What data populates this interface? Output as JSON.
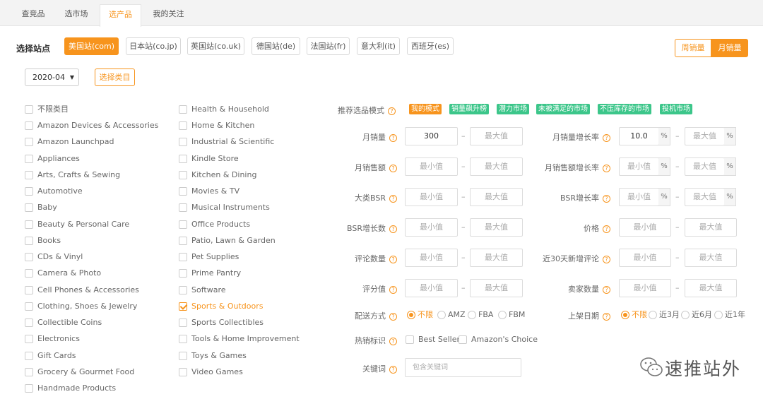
{
  "tabs": [
    "查竞品",
    "选市场",
    "选产品",
    "我的关注"
  ],
  "site_title": "选择站点",
  "sites": [
    "美国站(com)",
    "日本站(co.jp)",
    "英国站(co.uk)",
    "德国站(de)",
    "法国站(fr)",
    "意大利(it)",
    "西班牙(es)"
  ],
  "active_site": "美国站(com)",
  "sales_toggle": {
    "weekly": "周销量",
    "monthly": "月销量",
    "selected": "月销量"
  },
  "month": "2020-04",
  "select_category": "选择类目",
  "categories_left": [
    "不限类目",
    "Amazon Devices & Accessories",
    "Amazon Launchpad",
    "Appliances",
    "Arts, Crafts & Sewing",
    "Automotive",
    "Baby",
    "Beauty & Personal Care",
    "Books",
    "CDs & Vinyl",
    "Camera & Photo",
    "Cell Phones & Accessories",
    "Clothing, Shoes & Jewelry",
    "Collectible Coins",
    "Electronics",
    "Gift Cards",
    "Grocery & Gourmet Food",
    "Handmade Products"
  ],
  "categories_right": [
    "Health & Household",
    "Home & Kitchen",
    "Industrial & Scientific",
    "Kindle Store",
    "Kitchen & Dining",
    "Movies & TV",
    "Musical Instruments",
    "Office Products",
    "Patio, Lawn & Garden",
    "Pet Supplies",
    "Prime Pantry",
    "Software",
    "Sports & Outdoors",
    "Sports Collectibles",
    "Tools & Home Improvement",
    "Toys & Games",
    "Video Games"
  ],
  "checked_category": "Sports & Outdoors",
  "filters": {
    "mode_label": "推荐选品模式",
    "modes": [
      "我的模式",
      "销量飙升榜",
      "潜力市场",
      "未被满足的市场",
      "不压库存的市场",
      "投机市场"
    ],
    "active_mode": "我的模式",
    "min_placeholder": "最小值",
    "max_placeholder": "最大值",
    "dash": "–",
    "pct": "%",
    "help": "?",
    "monthly_sales": {
      "label": "月销量",
      "min": "300"
    },
    "monthly_sales_growth": {
      "label": "月销量增长率",
      "min": "10.0"
    },
    "monthly_revenue": {
      "label": "月销售额"
    },
    "monthly_revenue_growth": {
      "label": "月销售额增长率"
    },
    "category_bsr": {
      "label": "大类BSR"
    },
    "bsr_growth_rate": {
      "label": "BSR增长率"
    },
    "bsr_growth_count": {
      "label": "BSR增长数"
    },
    "price": {
      "label": "价格"
    },
    "review_count": {
      "label": "评论数量"
    },
    "new_reviews_30d": {
      "label": "近30天新增评论"
    },
    "rating": {
      "label": "评分值"
    },
    "seller_count": {
      "label": "卖家数量"
    },
    "fulfillment": {
      "label": "配送方式",
      "options": [
        "不限",
        "AMZ",
        "FBA",
        "FBM"
      ],
      "selected": "不限"
    },
    "listing_date": {
      "label": "上架日期",
      "options": [
        "不限",
        "近3月",
        "近6月",
        "近1年"
      ],
      "selected": "不限"
    },
    "badges": {
      "label": "热销标识",
      "options": [
        "Best Seller",
        "Amazon's Choice"
      ]
    },
    "keyword": {
      "label": "关键词",
      "placeholder": "包含关键词"
    }
  },
  "watermark": "速推站外",
  "colors": {
    "accent": "#f7941d",
    "green_tag": "#3cc68a"
  }
}
